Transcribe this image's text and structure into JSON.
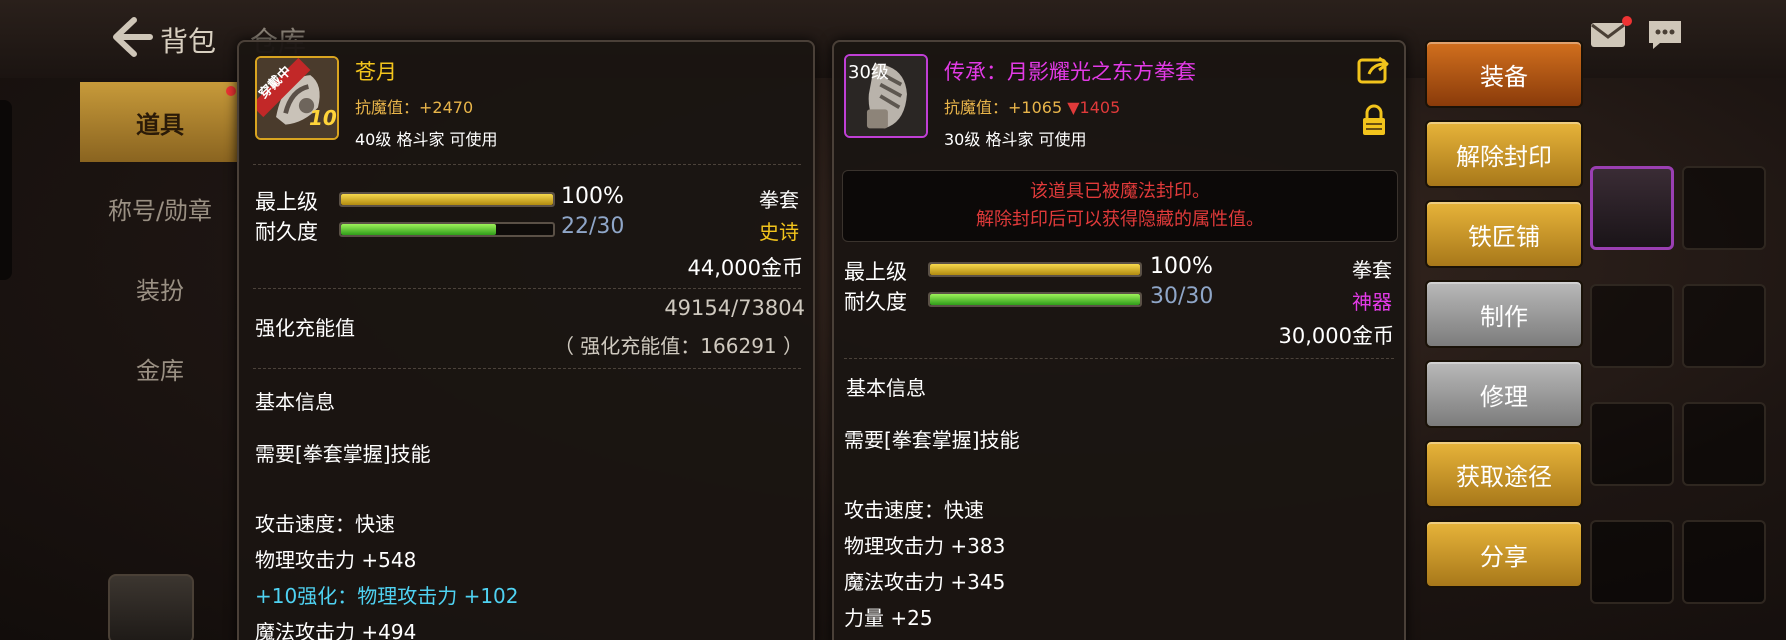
{
  "topbar": {
    "title": "背包",
    "title2": "仓库"
  },
  "leftnav": {
    "items": [
      {
        "label": "道具"
      },
      {
        "label": "称号/勋章"
      },
      {
        "label": "装扮"
      },
      {
        "label": "金库"
      }
    ]
  },
  "left_item": {
    "name": "苍月",
    "name_color": "#f2c41c",
    "badge": "穿戴中",
    "enhance_level": "10",
    "magic_resist": "抗魔值：+2470",
    "requirement": "40级 格斗家 可使用",
    "level_label": "最上级",
    "level_percent": 1.0,
    "level_text": "100%",
    "durability_label": "耐久度",
    "durability_ratio": 0.733,
    "durability_text": "22/30",
    "item_type": "拳套",
    "rarity": "史诗",
    "rarity_color": "#f2c41c",
    "price": "44,000金币",
    "charge_label": "强化充能值",
    "charge_value": "49154/73804",
    "charge_note": "（ 强化充能值：166291 ）",
    "section_title": "基本信息",
    "lines": [
      {
        "text": "需要[拳套掌握]技能",
        "color": "#ffffff"
      },
      {
        "text": "攻击速度：快速",
        "color": "#ffffff"
      },
      {
        "text": "物理攻击力 +548",
        "color": "#ffffff"
      },
      {
        "text": "+10强化：物理攻击力 +102",
        "color": "#4fd2f2"
      },
      {
        "text": "魔法攻击力 +494",
        "color": "#ffffff"
      }
    ]
  },
  "right_item": {
    "level_badge": "30级",
    "name": "传承：月影耀光之东方拳套",
    "name_color": "#e23ae6",
    "magic_resist": "抗魔值：+1065",
    "resist_diff": "▼1405",
    "requirement": "30级 格斗家 可使用",
    "sealed_line1": "该道具已被魔法封印。",
    "sealed_line2": "解除封印后可以获得隐藏的属性值。",
    "level_label": "最上级",
    "level_percent": 1.0,
    "level_text": "100%",
    "durability_label": "耐久度",
    "durability_ratio": 1.0,
    "durability_text": "30/30",
    "item_type": "拳套",
    "rarity": "神器",
    "rarity_color": "#e23ae6",
    "price": "30,000金币",
    "section_title": "基本信息",
    "lines": [
      {
        "text": "需要[拳套掌握]技能",
        "color": "#ffffff"
      },
      {
        "text": "攻击速度：快速",
        "color": "#ffffff"
      },
      {
        "text": "物理攻击力 +383",
        "color": "#ffffff"
      },
      {
        "text": "魔法攻击力 +345",
        "color": "#ffffff"
      },
      {
        "text": "力量 +25",
        "color": "#ffffff"
      }
    ]
  },
  "actions": [
    {
      "label": "装备",
      "style": "orange"
    },
    {
      "label": "解除封印",
      "style": "gold"
    },
    {
      "label": "铁匠铺",
      "style": "gold"
    },
    {
      "label": "制作",
      "style": "gray"
    },
    {
      "label": "修理",
      "style": "gray"
    },
    {
      "label": "获取途径",
      "style": "gold"
    },
    {
      "label": "分享",
      "style": "gold"
    }
  ],
  "icons": [
    "back-arrow-icon",
    "mail-icon",
    "chat-icon",
    "share-icon",
    "lock-icon"
  ]
}
